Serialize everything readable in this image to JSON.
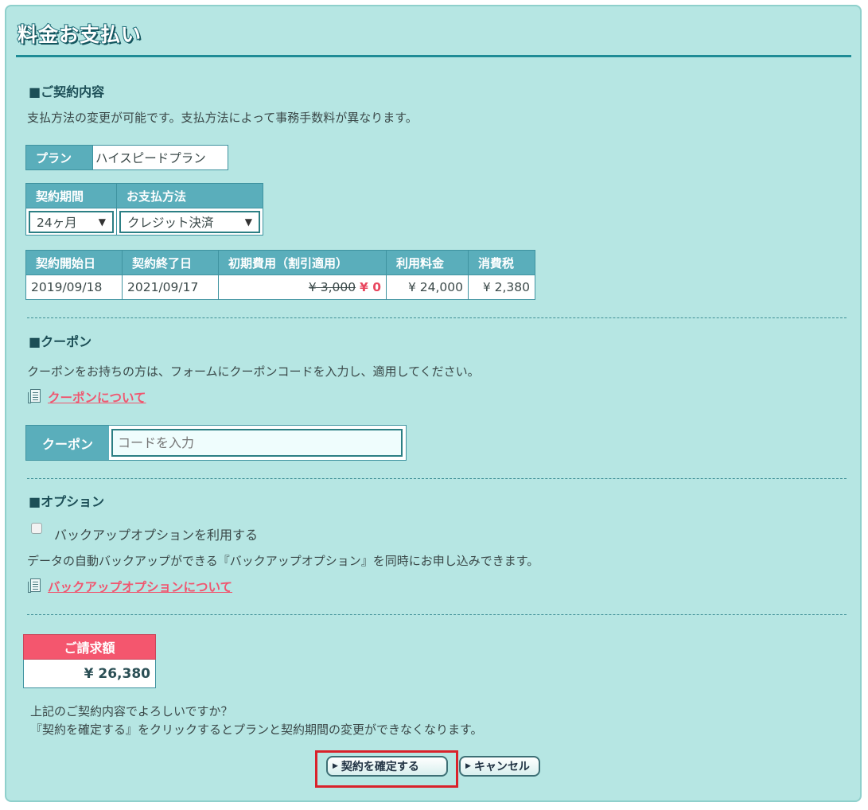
{
  "page": {
    "title": "料金お支払い"
  },
  "contract": {
    "heading": "■ご契約内容",
    "description": "支払方法の変更が可能です。支払方法によって事務手数料が異なります。",
    "plan_label": "プラン",
    "plan_value": "ハイスピードプラン",
    "period_label": "契約期間",
    "period_value": "24ヶ月",
    "payment_label": "お支払方法",
    "payment_value": "クレジット決済",
    "table": {
      "headers": [
        "契約開始日",
        "契約終了日",
        "初期費用（割引適用）",
        "利用料金",
        "消費税"
      ],
      "start_date": "2019/09/18",
      "end_date": "2021/09/17",
      "initial_fee_original": "¥ 3,000",
      "initial_fee_discounted": "¥ 0",
      "usage_fee": "¥ 24,000",
      "tax": "¥ 2,380"
    }
  },
  "coupon": {
    "heading": "■クーポン",
    "description": "クーポンをお持ちの方は、フォームにクーポンコードを入力し、適用してください。",
    "link": "クーポンについて",
    "label": "クーポン",
    "placeholder": "コードを入力",
    "value": ""
  },
  "option": {
    "heading": "■オプション",
    "checkbox_label": "バックアップオプションを利用する",
    "checked": false,
    "description": "データの自動バックアップができる『バックアップオプション』を同時にお申し込みできます。",
    "link": "バックアップオプションについて"
  },
  "billing": {
    "label": "ご請求額",
    "amount": "¥ 26,380"
  },
  "confirm": {
    "line1": "上記のご契約内容でよろしいですか？",
    "line2": "『契約を確定する』をクリックするとプランと契約期間の変更ができなくなります。",
    "confirm_button": "契約を確定する",
    "cancel_button": "キャンセル"
  },
  "colors": {
    "panel_bg": "#b6e6e3",
    "header_cell": "#5aaebb",
    "accent_link": "#f0566f",
    "bill_header": "#f4566e",
    "highlight": "#d9222b"
  }
}
